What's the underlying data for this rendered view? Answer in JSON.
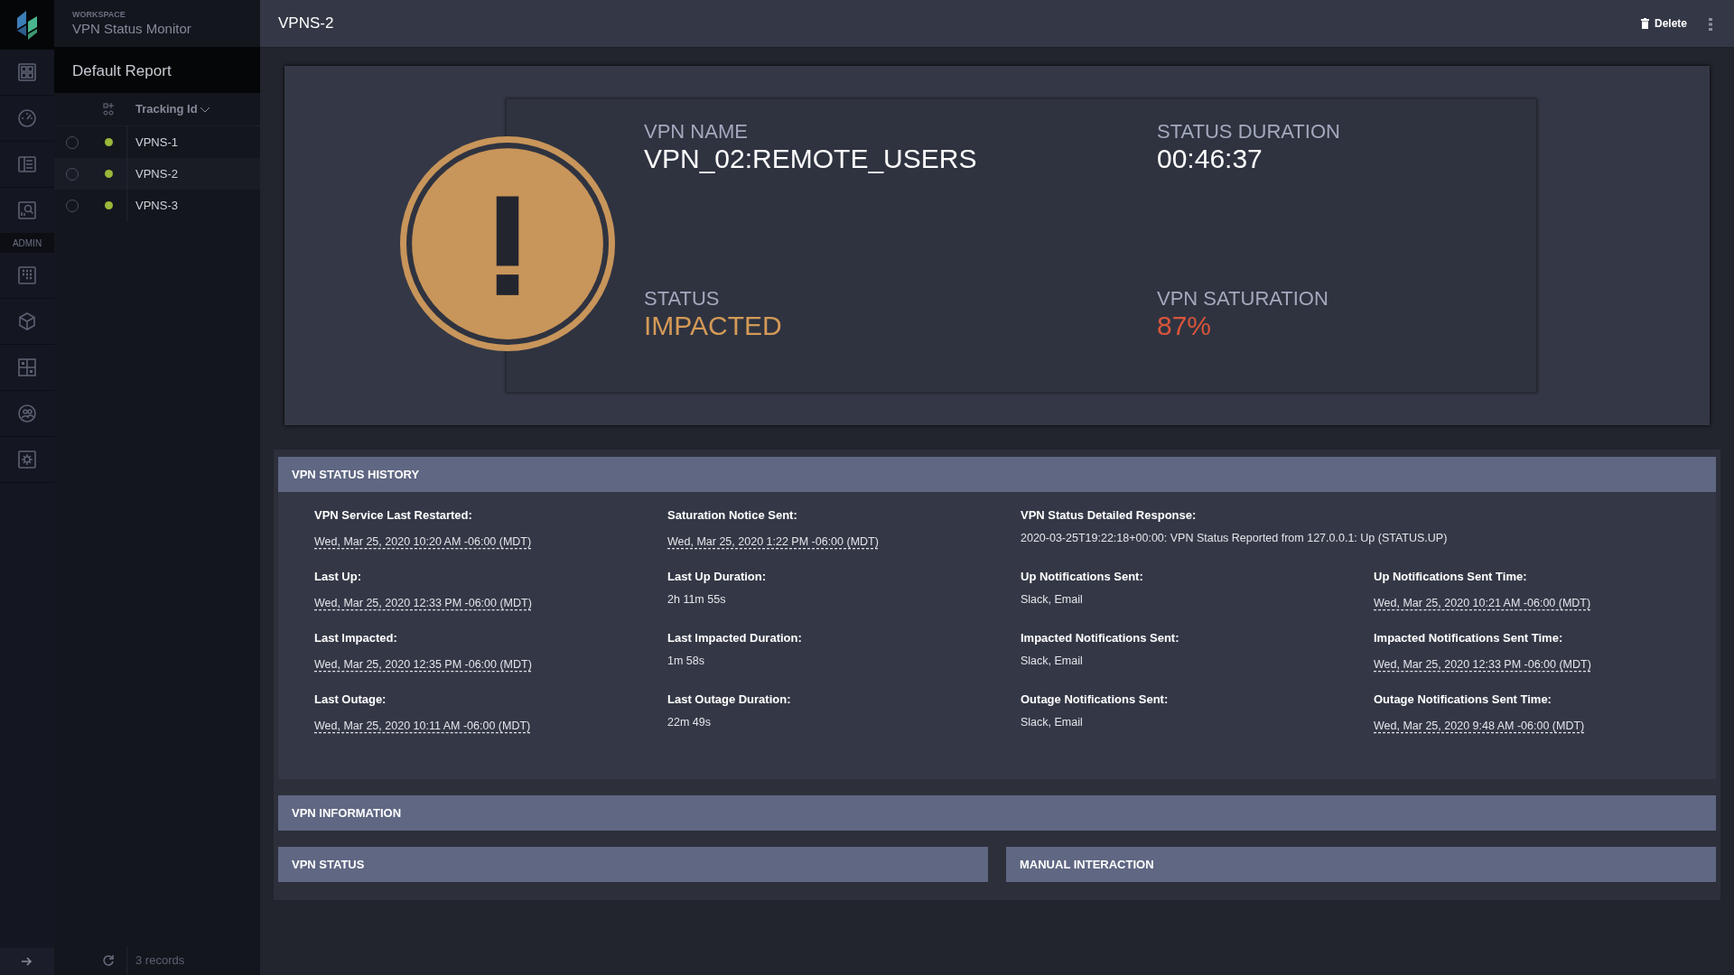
{
  "rail": {
    "admin_label": "ADMIN"
  },
  "workspace": {
    "caption": "WORKSPACE",
    "name": "VPN Status Monitor"
  },
  "report": {
    "title": "Default Report",
    "column": "Tracking Id",
    "rows": [
      {
        "id": "VPNS-1",
        "checked": false,
        "color": "#9ab83a"
      },
      {
        "id": "VPNS-2",
        "checked": false,
        "color": "#9ab83a"
      },
      {
        "id": "VPNS-3",
        "checked": false,
        "color": "#9ab83a"
      }
    ],
    "footer": "3 records"
  },
  "header": {
    "title": "VPNS-2",
    "delete": "Delete"
  },
  "status_card": {
    "metrics": [
      {
        "label": "VPN NAME",
        "value": "VPN_02:REMOTE_USERS",
        "color": "#ffffff"
      },
      {
        "label": "STATUS DURATION",
        "value": "00:46:37",
        "color": "#ffffff"
      },
      {
        "label": "STATUS",
        "value": "IMPACTED",
        "color": "#d49a57"
      },
      {
        "label": "VPN SATURATION",
        "value": "87%",
        "color": "#d9553b"
      }
    ]
  },
  "history": {
    "title": "VPN STATUS HISTORY",
    "rows": [
      [
        {
          "label": "VPN Service Last Restarted:",
          "value": "Wed, Mar 25, 2020 10:20 AM -06:00 (MDT)",
          "kind": "date"
        },
        {
          "label": "Saturation Notice Sent:",
          "value": "Wed, Mar 25, 2020 1:22 PM -06:00 (MDT)",
          "kind": "date"
        },
        {
          "label": "VPN Status Detailed Response:",
          "value": "2020-03-25T19:22:18+00:00: VPN Status Reported from 127.0.0.1: Up (STATUS.UP)",
          "kind": "text"
        }
      ],
      [
        {
          "label": "Last Up:",
          "value": "Wed, Mar 25, 2020 12:33 PM -06:00 (MDT)",
          "kind": "date"
        },
        {
          "label": "Last Up Duration:",
          "value": "2h 11m 55s",
          "kind": "text"
        },
        {
          "label": "Up Notifications Sent:",
          "value": "Slack, Email",
          "kind": "text"
        },
        {
          "label": "Up Notifications Sent Time:",
          "value": "Wed, Mar 25, 2020 10:21 AM -06:00 (MDT)",
          "kind": "date"
        }
      ],
      [
        {
          "label": "Last Impacted:",
          "value": "Wed, Mar 25, 2020 12:35 PM -06:00 (MDT)",
          "kind": "date"
        },
        {
          "label": "Last Impacted Duration:",
          "value": "1m 58s",
          "kind": "text"
        },
        {
          "label": "Impacted Notifications Sent:",
          "value": "Slack, Email",
          "kind": "text"
        },
        {
          "label": "Impacted Notifications Sent Time:",
          "value": "Wed, Mar 25, 2020 12:33 PM -06:00 (MDT)",
          "kind": "date"
        }
      ],
      [
        {
          "label": "Last Outage:",
          "value": "Wed, Mar 25, 2020 10:11 AM -06:00 (MDT)",
          "kind": "date"
        },
        {
          "label": "Last Outage Duration:",
          "value": "22m 49s",
          "kind": "text"
        },
        {
          "label": "Outage Notifications Sent:",
          "value": "Slack, Email",
          "kind": "text"
        },
        {
          "label": "Outage Notifications Sent Time:",
          "value": "Wed, Mar 25, 2020 9:48 AM -06:00 (MDT)",
          "kind": "date"
        }
      ]
    ]
  },
  "sections": [
    {
      "title": "VPN INFORMATION"
    }
  ],
  "split_sections": [
    {
      "title": "VPN STATUS"
    },
    {
      "title": "MANUAL INTERACTION"
    }
  ]
}
